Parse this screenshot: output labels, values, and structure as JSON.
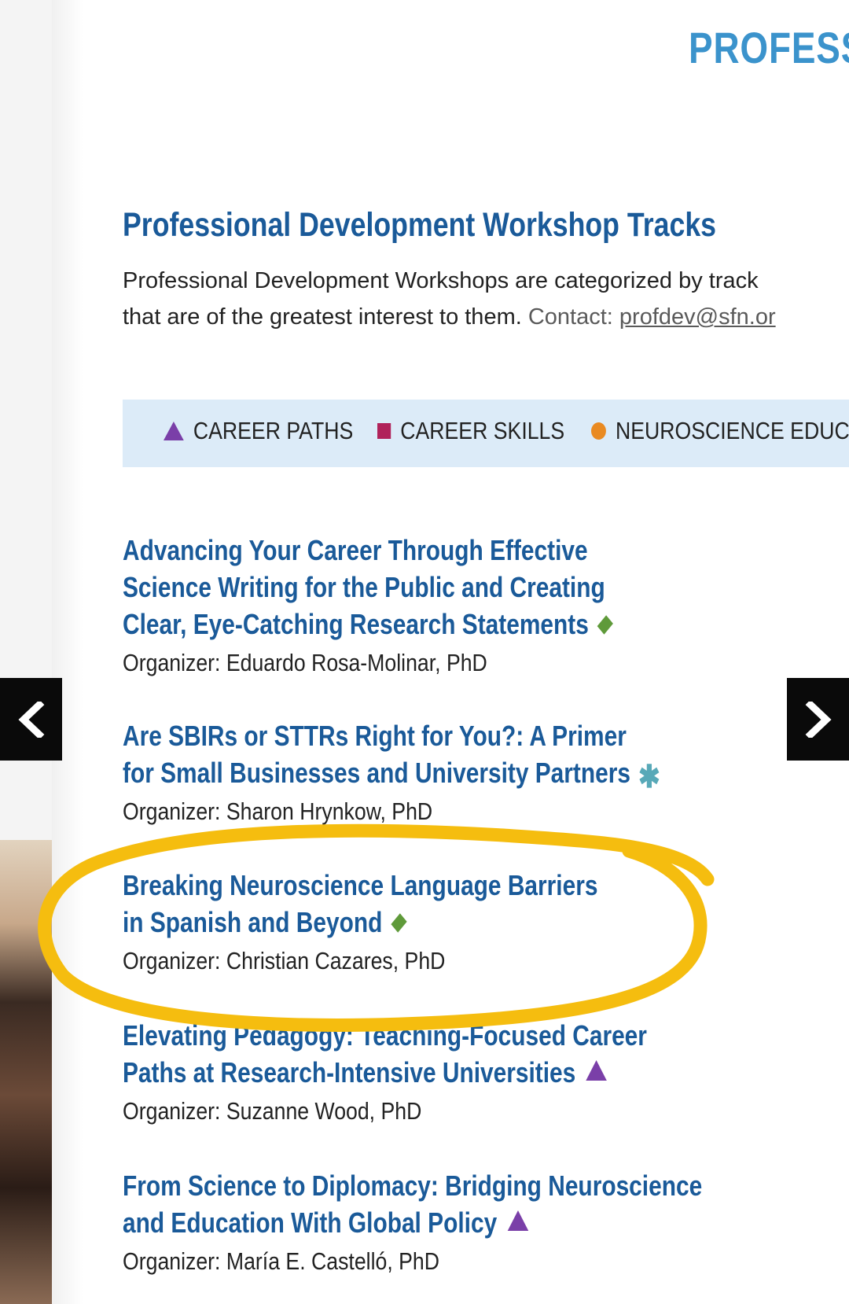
{
  "header": {
    "title_fragment": "PROFESS"
  },
  "section": {
    "title": "Professional Development Workshop Tracks",
    "intro_line1": "Professional Development Workshops are categorized by track",
    "intro_line2": "that are of the greatest interest to them.",
    "contact_label": "Contact:",
    "contact_email": "profdev@sfn.or"
  },
  "legend": {
    "items": [
      {
        "label": "CAREER PATHS",
        "icon": "triangle-icon",
        "color": "#7a3fa8"
      },
      {
        "label": "CAREER SKILLS",
        "icon": "square-icon",
        "color": "#b0225a"
      },
      {
        "label": "NEUROSCIENCE EDUCA",
        "icon": "circle-icon",
        "color": "#e98a22"
      }
    ]
  },
  "workshops": [
    {
      "title_lines": [
        "Advancing Your Career Through Effective",
        "Science Writing for the Public and Creating",
        "Clear, Eye-Catching Research Statements"
      ],
      "track_icon": "diamond-icon",
      "organizer": "Organizer: Eduardo Rosa-Molinar, PhD"
    },
    {
      "title_lines": [
        "Are SBIRs or STTRs Right for You?: A Primer",
        "for Small Businesses and University Partners"
      ],
      "track_icon": "asterisk-icon",
      "organizer": "Organizer: Sharon Hrynkow, PhD"
    },
    {
      "title_lines": [
        "Breaking Neuroscience Language Barriers",
        "in Spanish and Beyond"
      ],
      "track_icon": "diamond-icon",
      "organizer": "Organizer: Christian Cazares, PhD",
      "highlighted": true
    },
    {
      "title_lines": [
        "Elevating Pedagogy: Teaching-Focused Career",
        "Paths at Research-Intensive Universities"
      ],
      "track_icon": "triangle-icon",
      "organizer": "Organizer: Suzanne Wood, PhD"
    },
    {
      "title_lines": [
        "From Science to Diplomacy: Bridging Neuroscience",
        "and Education With Global Policy"
      ],
      "track_icon": "triangle-icon",
      "organizer": "Organizer: María E. Castelló, PhD"
    }
  ],
  "navigation": {
    "prev_icon": "chevron-left-icon",
    "next_icon": "chevron-right-icon"
  },
  "colors": {
    "heading_blue": "#1a5a99",
    "header_light_blue": "#3b93cc",
    "legend_background": "#dcebf8",
    "highlight_yellow": "#f5bd0f",
    "diamond_green": "#5f9a3a",
    "asterisk_teal": "#58a9b8"
  }
}
